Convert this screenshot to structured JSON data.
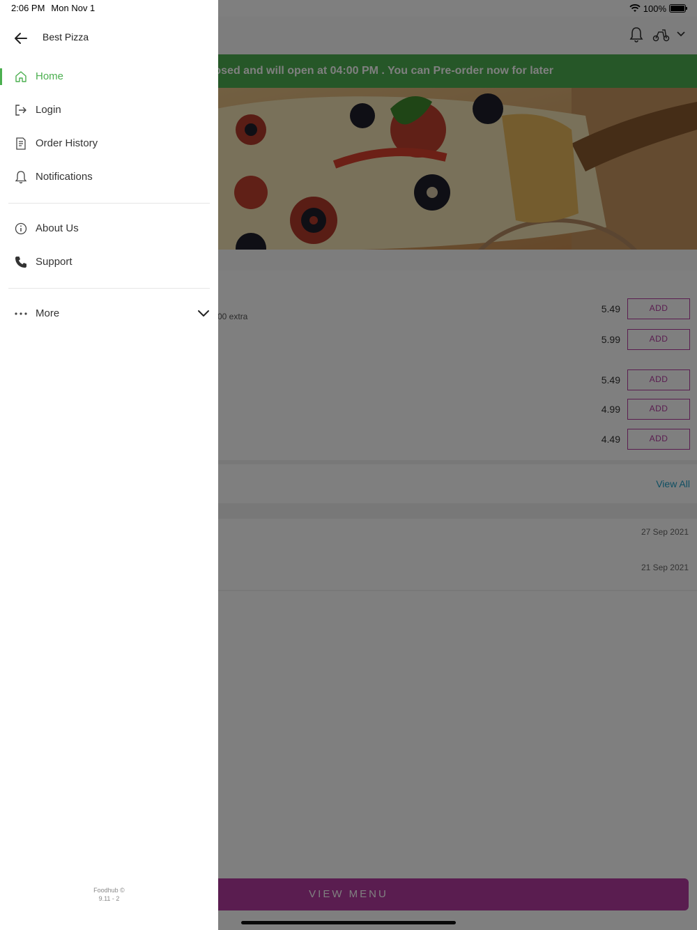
{
  "status_bar": {
    "time": "2:06 PM",
    "date": "Mon Nov 1",
    "battery": "100%"
  },
  "drawer": {
    "title": "Best Pizza",
    "items": [
      {
        "label": "Home",
        "icon": "home-icon",
        "active": true
      },
      {
        "label": "Login",
        "icon": "login-icon"
      },
      {
        "label": "Order History",
        "icon": "order-history-icon"
      },
      {
        "label": "Notifications",
        "icon": "bell-icon"
      }
    ],
    "secondary_items": [
      {
        "label": "About Us",
        "icon": "info-icon"
      },
      {
        "label": "Support",
        "icon": "phone-icon"
      }
    ],
    "more_label": "More",
    "footer": {
      "brand": "Foodhub ©",
      "version": "9.11 - 2"
    }
  },
  "background": {
    "banner_text": "osed and will open at 04:00 PM . You can Pre-order now for later",
    "item_extra_text": "00 extra",
    "items": [
      {
        "price": "5.49",
        "add_label": "ADD"
      },
      {
        "price": "5.99",
        "add_label": "ADD"
      },
      {
        "price": "5.49",
        "add_label": "ADD"
      },
      {
        "price": "4.99",
        "add_label": "ADD"
      },
      {
        "price": "4.49",
        "add_label": "ADD"
      }
    ],
    "view_all": "View All",
    "review_dates": [
      "27 Sep 2021",
      "21 Sep 2021"
    ],
    "view_menu": "VIEW MENU"
  },
  "colors": {
    "accent_green": "#4caf50",
    "brand_purple": "#b43aa1",
    "link_blue": "#1f9ec6",
    "overlay": "rgba(0,0,0,0.5)"
  }
}
